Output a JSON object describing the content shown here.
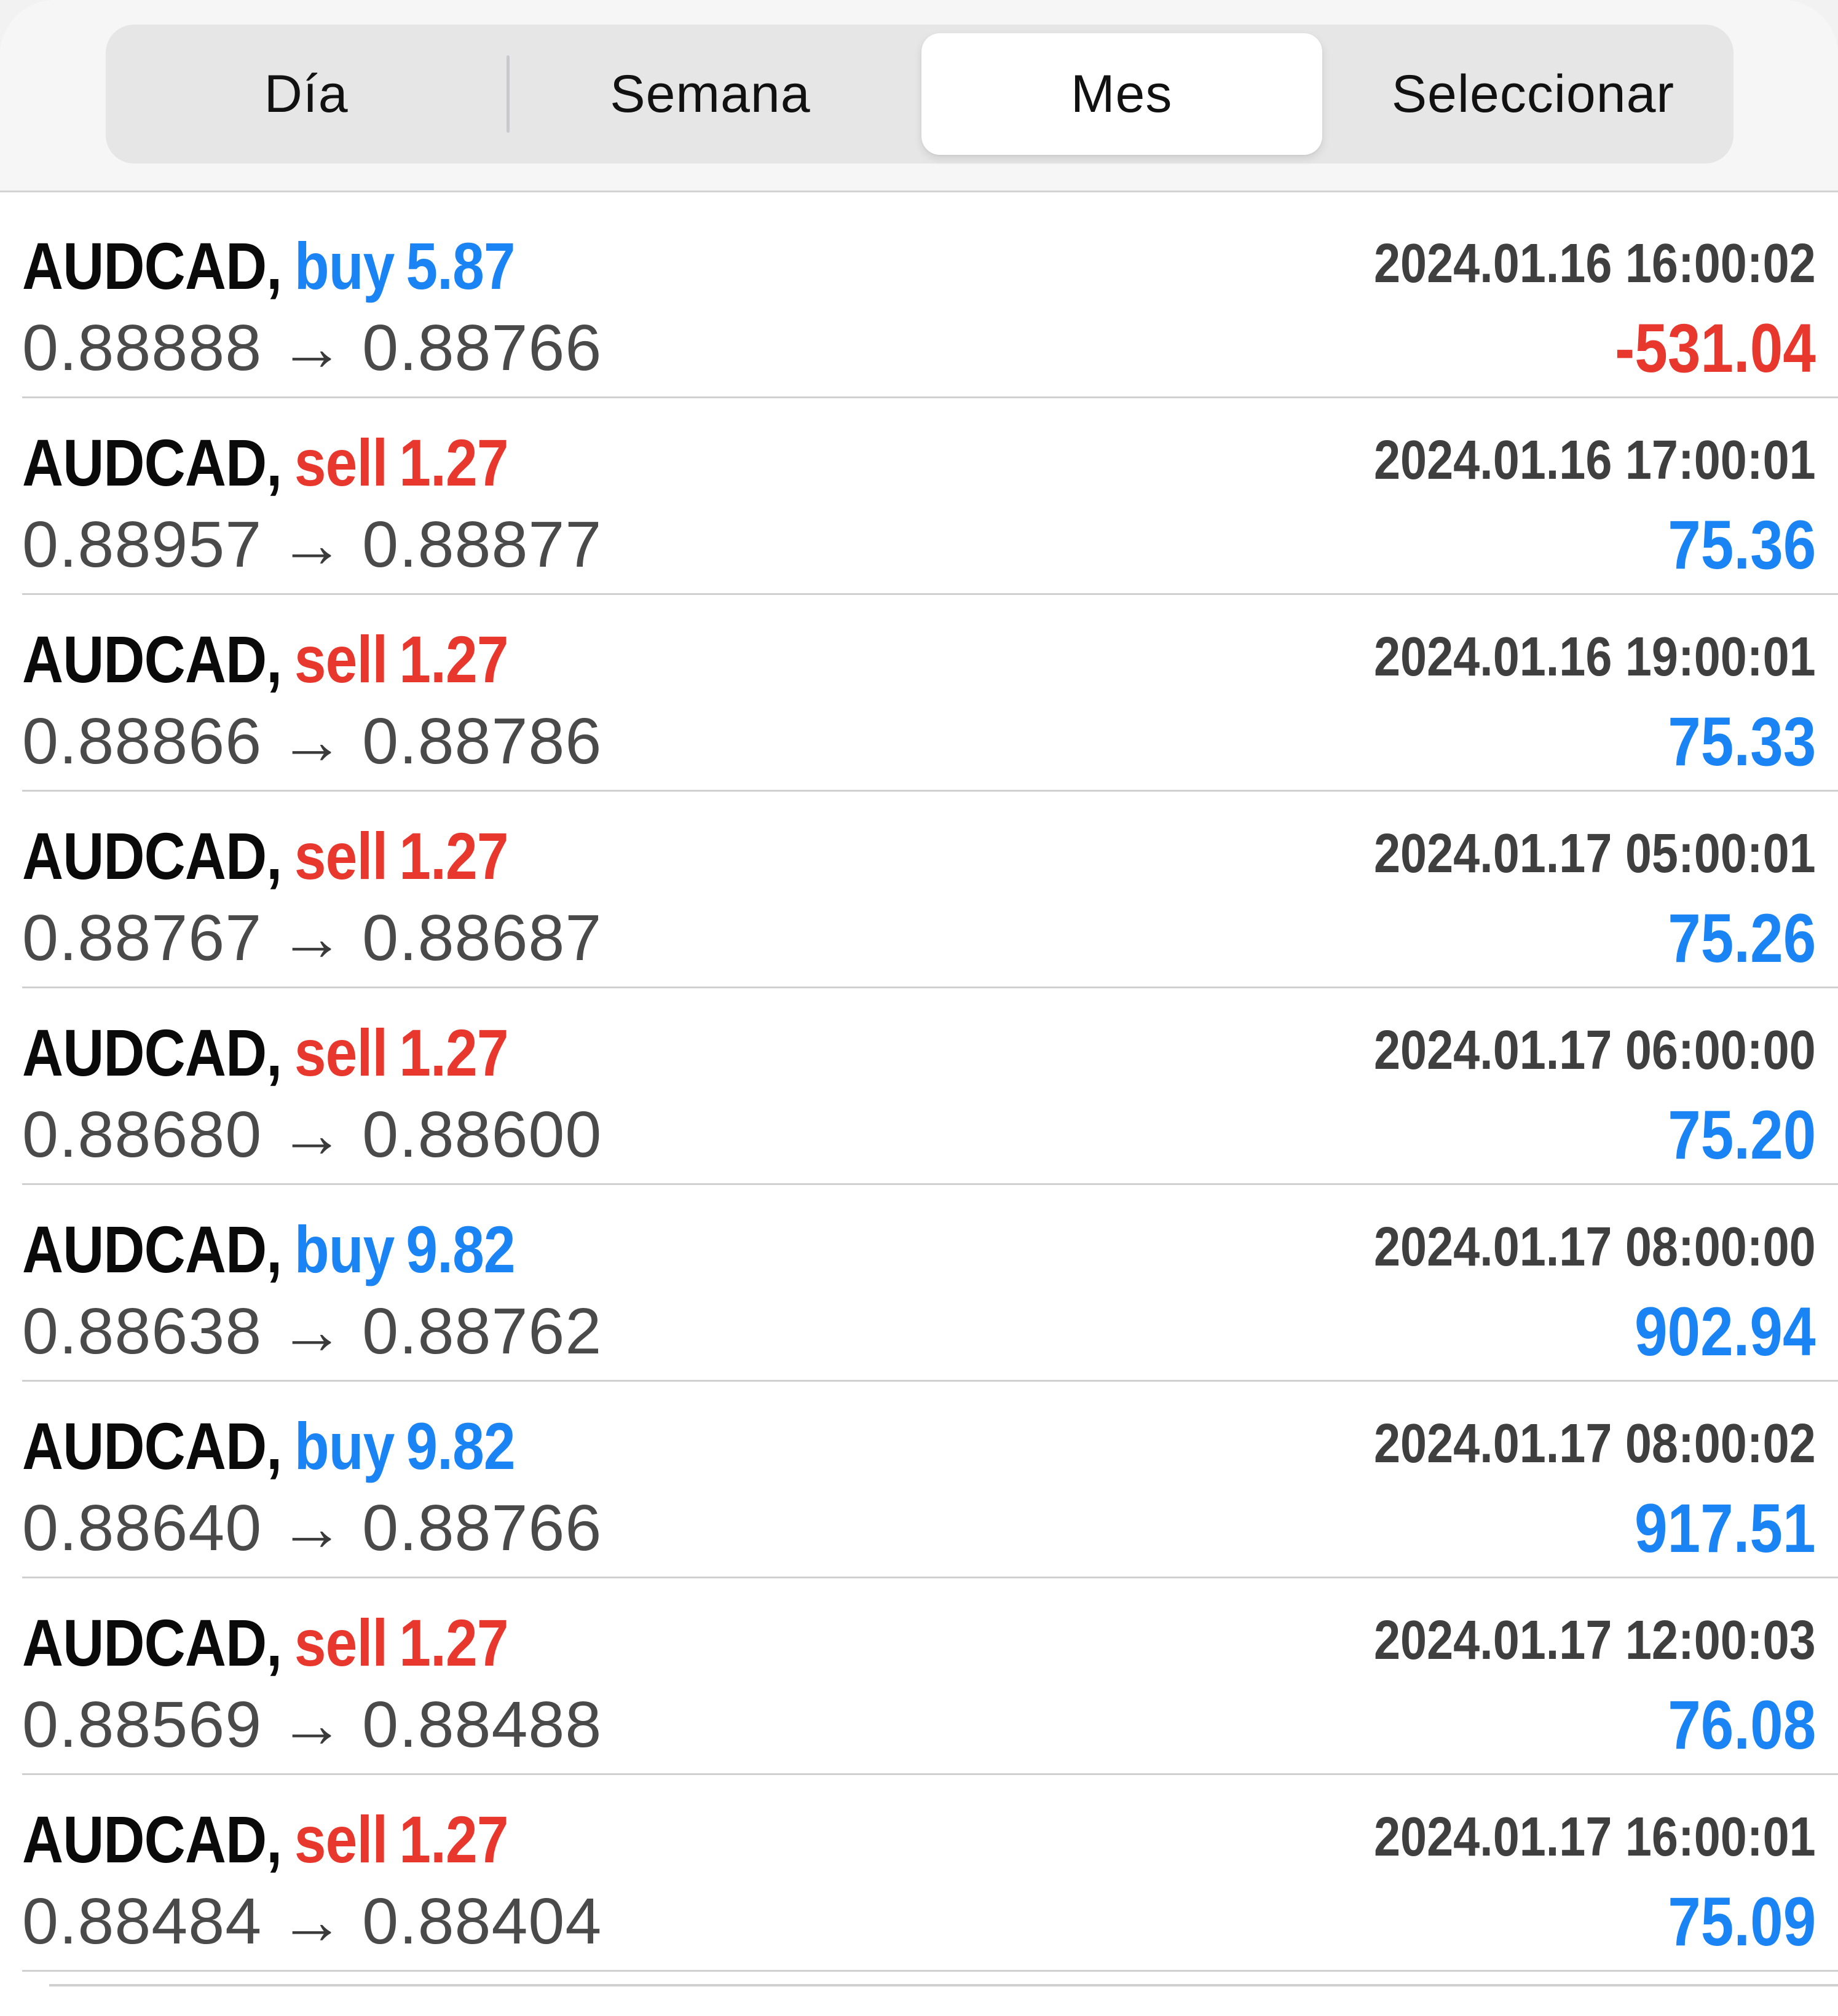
{
  "tabs": [
    {
      "label": "Día"
    },
    {
      "label": "Semana"
    },
    {
      "label": "Mes"
    },
    {
      "label": "Seleccionar"
    }
  ],
  "active_tab": "Mes",
  "trades": [
    {
      "symbol": "AUDCAD,",
      "type": "buy",
      "volume": "5.87",
      "time": "2024.01.16 16:00:02",
      "open": "0.88888",
      "arrow": "→",
      "close": "0.88766",
      "profit": "-531.04"
    },
    {
      "symbol": "AUDCAD,",
      "type": "sell",
      "volume": "1.27",
      "time": "2024.01.16 17:00:01",
      "open": "0.88957",
      "arrow": "→",
      "close": "0.88877",
      "profit": "75.36"
    },
    {
      "symbol": "AUDCAD,",
      "type": "sell",
      "volume": "1.27",
      "time": "2024.01.16 19:00:01",
      "open": "0.88866",
      "arrow": "→",
      "close": "0.88786",
      "profit": "75.33"
    },
    {
      "symbol": "AUDCAD,",
      "type": "sell",
      "volume": "1.27",
      "time": "2024.01.17 05:00:01",
      "open": "0.88767",
      "arrow": "→",
      "close": "0.88687",
      "profit": "75.26"
    },
    {
      "symbol": "AUDCAD,",
      "type": "sell",
      "volume": "1.27",
      "time": "2024.01.17 06:00:00",
      "open": "0.88680",
      "arrow": "→",
      "close": "0.88600",
      "profit": "75.20"
    },
    {
      "symbol": "AUDCAD,",
      "type": "buy",
      "volume": "9.82",
      "time": "2024.01.17 08:00:00",
      "open": "0.88638",
      "arrow": "→",
      "close": "0.88762",
      "profit": "902.94"
    },
    {
      "symbol": "AUDCAD,",
      "type": "buy",
      "volume": "9.82",
      "time": "2024.01.17 08:00:02",
      "open": "0.88640",
      "arrow": "→",
      "close": "0.88766",
      "profit": "917.51"
    },
    {
      "symbol": "AUDCAD,",
      "type": "sell",
      "volume": "1.27",
      "time": "2024.01.17 12:00:03",
      "open": "0.88569",
      "arrow": "→",
      "close": "0.88488",
      "profit": "76.08"
    },
    {
      "symbol": "AUDCAD,",
      "type": "sell",
      "volume": "1.27",
      "time": "2024.01.17 16:00:01",
      "open": "0.88484",
      "arrow": "→",
      "close": "0.88404",
      "profit": "75.09"
    }
  ],
  "colors": {
    "buy": "#1a84f5",
    "sell": "#e8382e",
    "profit_positive": "#1a84f5",
    "profit_negative": "#e8382e"
  }
}
